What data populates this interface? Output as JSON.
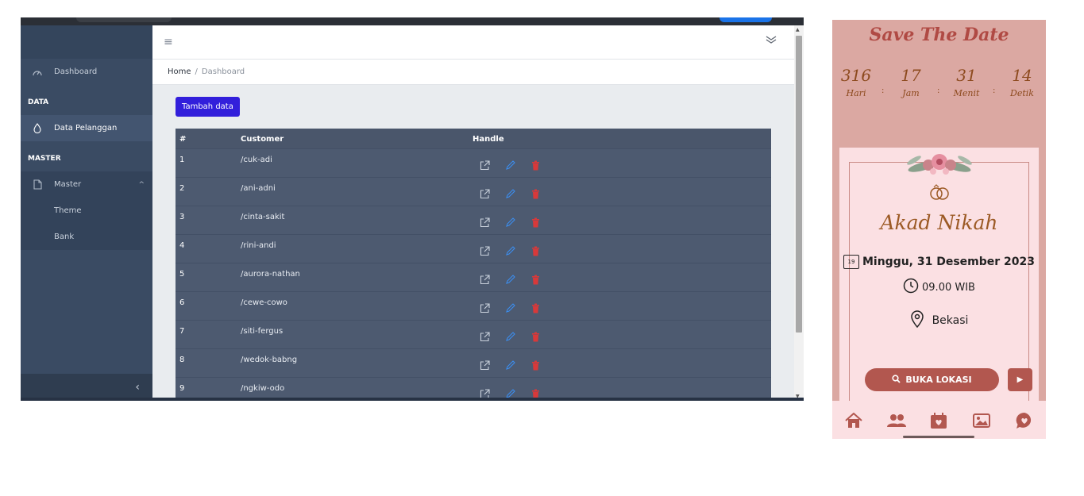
{
  "sidebar": {
    "items": [
      {
        "label": "Dashboard"
      }
    ],
    "section_data": "DATA",
    "data_item": "Data Pelanggan",
    "section_master": "MASTER",
    "master_item": "Master",
    "sub_items": [
      "Theme",
      "Bank"
    ]
  },
  "breadcrumb": {
    "home": "Home",
    "separator": "/",
    "current": "Dashboard"
  },
  "toolbar": {
    "add_label": "Tambah data"
  },
  "table": {
    "headers": [
      "#",
      "Customer",
      "Handle"
    ],
    "rows": [
      {
        "no": "1",
        "customer": "/cuk-adi"
      },
      {
        "no": "2",
        "customer": "/ani-adni"
      },
      {
        "no": "3",
        "customer": "/cinta-sakit"
      },
      {
        "no": "4",
        "customer": "/rini-andi"
      },
      {
        "no": "5",
        "customer": "/aurora-nathan"
      },
      {
        "no": "6",
        "customer": "/cewe-cowo"
      },
      {
        "no": "7",
        "customer": "/siti-fergus"
      },
      {
        "no": "8",
        "customer": "/wedok-babng"
      },
      {
        "no": "9",
        "customer": "/ngkiw-odo"
      }
    ]
  },
  "invite": {
    "title": "Save The Date",
    "countdown": [
      {
        "num": "316",
        "label": "Hari"
      },
      {
        "num": "17",
        "label": "Jam"
      },
      {
        "num": "31",
        "label": "Menit"
      },
      {
        "num": "14",
        "label": "Detik"
      }
    ],
    "countdown_sep": ":",
    "event": "Akad Nikah",
    "calendar_day": "19",
    "date": "Minggu, 31 Desember 2023",
    "time": "09.00 WIB",
    "place": "Bekasi",
    "button": "BUKA LOKASI"
  },
  "colors": {
    "accent": "#321fdb",
    "sidebar_bg": "#3a4b63",
    "invite_bg": "#dba8a2",
    "invite_card": "#fbe0e3",
    "invite_button": "#b2574f"
  }
}
